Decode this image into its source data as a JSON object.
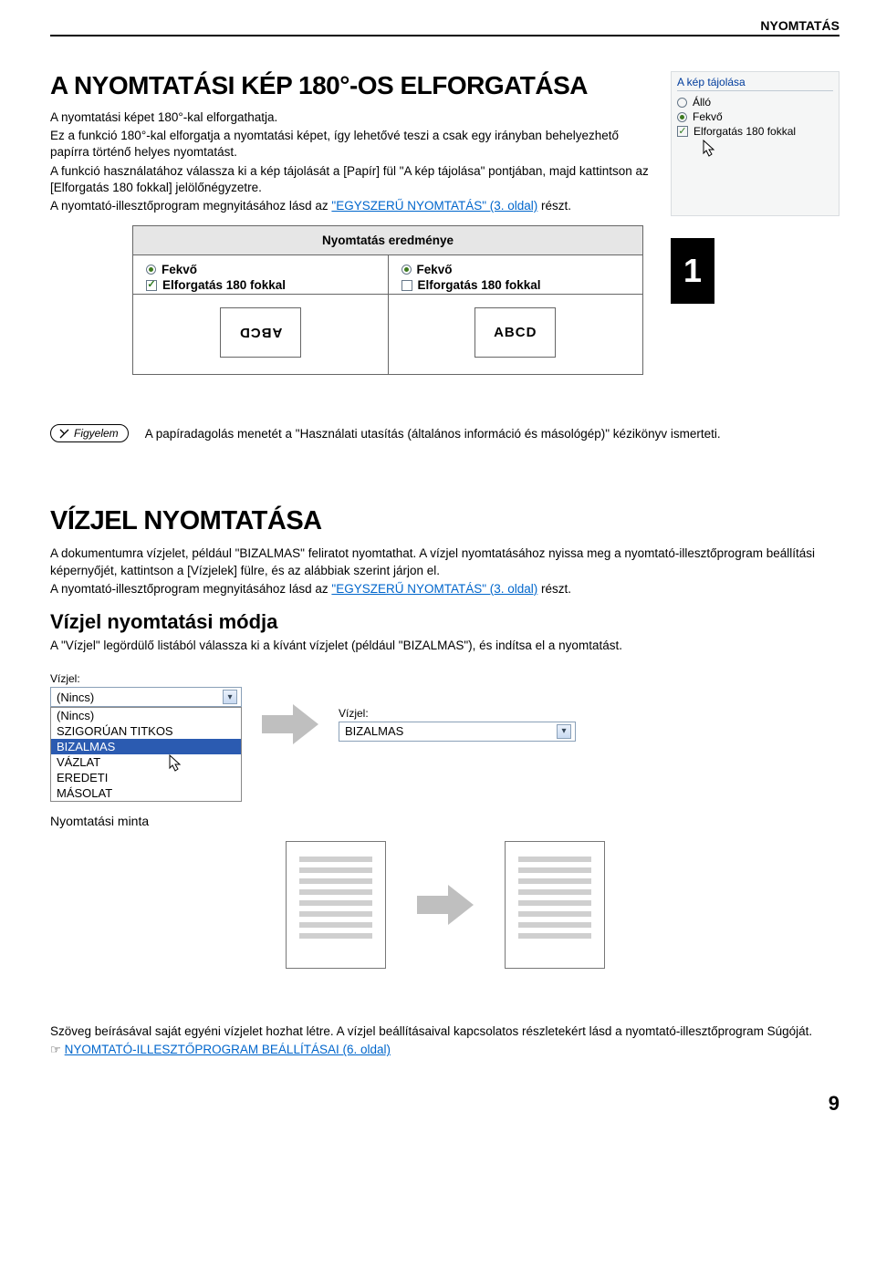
{
  "header": {
    "section": "NYOMTATÁS"
  },
  "rotate": {
    "title": "A NYOMTATÁSI KÉP 180°-OS ELFORGATÁSA",
    "p1": "A nyomtatási képet 180°-kal elforgathatja.",
    "p2": "Ez a funkció 180°-kal elforgatja a nyomtatási képet, így lehetővé teszi a csak egy irányban behelyezhető papírra történő helyes nyomtatást.",
    "p3": "A funkció használatához válassza ki a kép tájolását a [Papír] fül \"A kép tájolása\" pontjában, majd kattintson az [Elforgatás 180 fokkal] jelölőnégyzetre.",
    "p4_pre": "A nyomtató-illesztőprogram megnyitásához lásd az ",
    "p4_link": "\"EGYSZERŰ NYOMTATÁS\" (3. oldal)",
    "p4_post": " részt."
  },
  "orientation_panel": {
    "title": "A kép tájolása",
    "opt1": "Álló",
    "opt2": "Fekvő",
    "check": "Elforgatás 180 fokkal"
  },
  "result": {
    "head": "Nyomtatás eredménye",
    "left_radio": "Fekvő",
    "left_check": "Elforgatás 180 fokkal",
    "right_radio": "Fekvő",
    "right_check": "Elforgatás 180 fokkal",
    "left_preview": "ABCD",
    "right_preview": "ABCD"
  },
  "side_tab": "1",
  "note": {
    "badge": "Figyelem",
    "text": "A papíradagolás menetét a \"Használati utasítás (általános információ és másológép)\" kézikönyv ismerteti."
  },
  "watermark": {
    "title": "VÍZJEL NYOMTATÁSA",
    "p1": "A dokumentumra vízjelet, például \"BIZALMAS\" feliratot nyomtathat. A vízjel nyomtatásához nyissa meg a nyomtató-illesztőprogram beállítási képernyőjét, kattintson a [Vízjelek] fülre, és az alábbiak szerint járjon el.",
    "p2_pre": "A nyomtató-illesztőprogram megnyitásához lásd az ",
    "p2_link": "\"EGYSZERŰ NYOMTATÁS\" (3. oldal)",
    "p2_post": " részt.",
    "sub": "Vízjel nyomtatási módja",
    "p3": "A \"Vízjel\" legördülő listából válassza ki a kívánt vízjelet (például \"BIZALMAS\"), és indítsa el a nyomtatást."
  },
  "dropdown": {
    "label_left": "Vízjel:",
    "selected_left": "(Nincs)",
    "options": [
      "(Nincs)",
      "SZIGORÚAN TITKOS",
      "BIZALMAS",
      "VÁZLAT",
      "EREDETI",
      "MÁSOLAT"
    ],
    "selected_option_index": 2,
    "label_right": "Vízjel:",
    "selected_right": "BIZALMAS"
  },
  "sample_label": "Nyomtatási minta",
  "footer": {
    "p1": "Szöveg beírásával saját egyéni vízjelet hozhat létre. A vízjel beállításaival kapcsolatos részletekért lásd a nyomtató-illesztőprogram Súgóját.",
    "link": "NYOMTATÓ-ILLESZTŐPROGRAM BEÁLLÍTÁSAI (6. oldal)"
  },
  "page_num": "9"
}
